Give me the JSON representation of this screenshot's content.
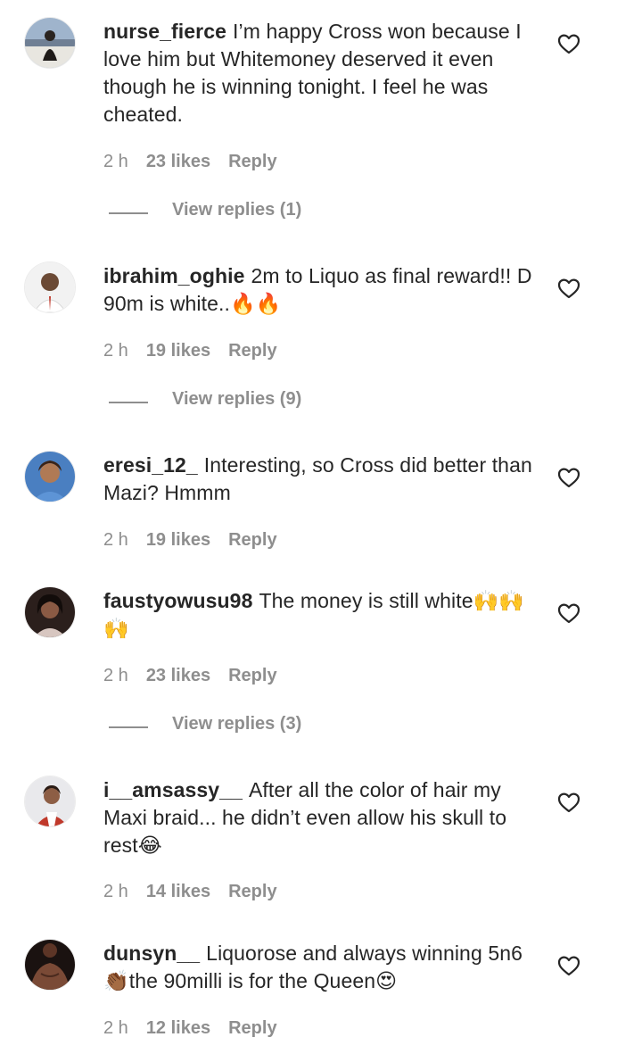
{
  "comments": [
    {
      "username": "nurse_fierce",
      "text": "I’m happy Cross won because I love him but Whitemoney deserved it even though he is winning tonight. I feel he was cheated.",
      "time": "2 h",
      "likes": "23 likes",
      "reply": "Reply",
      "view_replies": "View replies (1)"
    },
    {
      "username": "ibrahim_oghie",
      "text": "2m to Liquo as final reward!! D 90m is white..🔥🔥",
      "time": "2 h",
      "likes": "19 likes",
      "reply": "Reply",
      "view_replies": "View replies (9)"
    },
    {
      "username": "eresi_12_",
      "text": "Interesting, so Cross did better than Mazi? Hmmm",
      "time": "2 h",
      "likes": "19 likes",
      "reply": "Reply"
    },
    {
      "username": "faustyowusu98",
      "text": "The money is still white🙌🙌🙌",
      "time": "2 h",
      "likes": "23 likes",
      "reply": "Reply",
      "view_replies": "View replies (3)"
    },
    {
      "username": "i__amsassy__",
      "text": "After all the color of hair my Maxi braid... he didn’t even allow his skull to rest😂",
      "time": "2 h",
      "likes": "14 likes",
      "reply": "Reply"
    },
    {
      "username": "dunsyn__",
      "text": "Liquorose and always winning 5n6👏🏾the 90milli is for the Queen😍",
      "time": "2 h",
      "likes": "12 likes",
      "reply": "Reply"
    }
  ],
  "icons": {
    "like": "heart-outline-icon"
  },
  "colors": {
    "text": "#262626",
    "muted": "#8e8e8e",
    "background": "#ffffff"
  }
}
